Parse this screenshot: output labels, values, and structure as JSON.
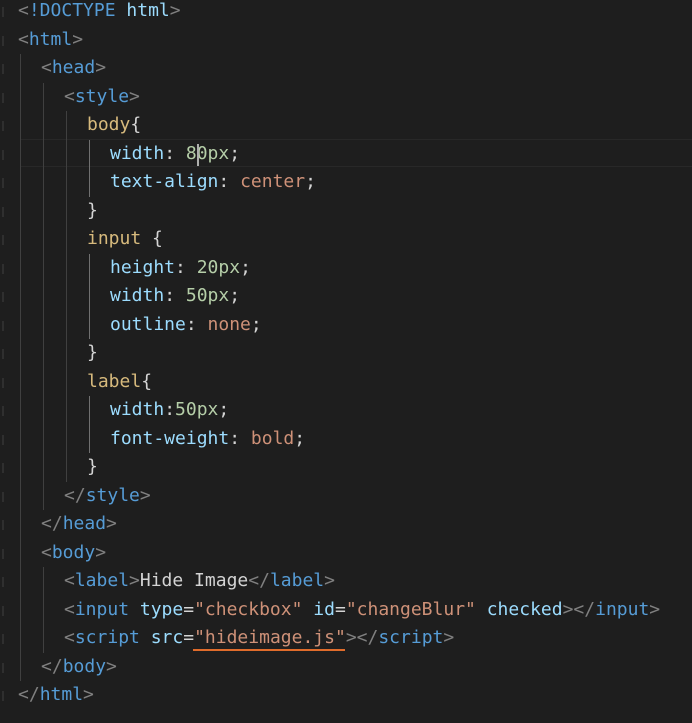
{
  "colors": {
    "background": "#1e1e1e",
    "punctuation": "#808080",
    "tag": "#569cd6",
    "attribute": "#9cdcfe",
    "string": "#ce9178",
    "selector": "#d7ba7d",
    "number": "#b5cea8",
    "text": "#d4d4d4"
  },
  "code": {
    "lines": [
      {
        "indent": 0,
        "tokens": [
          {
            "t": "<",
            "c": "punctuation"
          },
          {
            "t": "!DOCTYPE",
            "c": "tag"
          },
          {
            "t": " ",
            "c": "text"
          },
          {
            "t": "html",
            "c": "attribute"
          },
          {
            "t": ">",
            "c": "punctuation"
          }
        ]
      },
      {
        "indent": 0,
        "tokens": [
          {
            "t": "<",
            "c": "punctuation"
          },
          {
            "t": "html",
            "c": "tag"
          },
          {
            "t": ">",
            "c": "punctuation"
          }
        ]
      },
      {
        "indent": 1,
        "tokens": [
          {
            "t": "<",
            "c": "punctuation"
          },
          {
            "t": "head",
            "c": "tag"
          },
          {
            "t": ">",
            "c": "punctuation"
          }
        ]
      },
      {
        "indent": 2,
        "tokens": [
          {
            "t": "<",
            "c": "punctuation"
          },
          {
            "t": "style",
            "c": "tag"
          },
          {
            "t": ">",
            "c": "punctuation"
          }
        ]
      },
      {
        "indent": 3,
        "tokens": [
          {
            "t": "body",
            "c": "selector"
          },
          {
            "t": "{",
            "c": "text"
          }
        ]
      },
      {
        "indent": 4,
        "tokens": [
          {
            "t": "width",
            "c": "attribute"
          },
          {
            "t": ": ",
            "c": "text"
          },
          {
            "t": "80px",
            "c": "number"
          },
          {
            "t": ";",
            "c": "text"
          }
        ]
      },
      {
        "indent": 4,
        "tokens": [
          {
            "t": "text-align",
            "c": "attribute"
          },
          {
            "t": ": ",
            "c": "text"
          },
          {
            "t": "center",
            "c": "string"
          },
          {
            "t": ";",
            "c": "text"
          }
        ]
      },
      {
        "indent": 3,
        "tokens": [
          {
            "t": "}",
            "c": "text"
          }
        ]
      },
      {
        "indent": 3,
        "tokens": [
          {
            "t": "input",
            "c": "selector"
          },
          {
            "t": " {",
            "c": "text"
          }
        ]
      },
      {
        "indent": 4,
        "tokens": [
          {
            "t": "height",
            "c": "attribute"
          },
          {
            "t": ": ",
            "c": "text"
          },
          {
            "t": "20px",
            "c": "number"
          },
          {
            "t": ";",
            "c": "text"
          }
        ]
      },
      {
        "indent": 4,
        "tokens": [
          {
            "t": "width",
            "c": "attribute"
          },
          {
            "t": ": ",
            "c": "text"
          },
          {
            "t": "50px",
            "c": "number"
          },
          {
            "t": ";",
            "c": "text"
          }
        ]
      },
      {
        "indent": 4,
        "tokens": [
          {
            "t": "outline",
            "c": "attribute"
          },
          {
            "t": ": ",
            "c": "text"
          },
          {
            "t": "none",
            "c": "string"
          },
          {
            "t": ";",
            "c": "text"
          }
        ]
      },
      {
        "indent": 3,
        "tokens": [
          {
            "t": "}",
            "c": "text"
          }
        ]
      },
      {
        "indent": 3,
        "tokens": [
          {
            "t": "label",
            "c": "selector"
          },
          {
            "t": "{",
            "c": "text"
          }
        ]
      },
      {
        "indent": 4,
        "tokens": [
          {
            "t": "width",
            "c": "attribute"
          },
          {
            "t": ":",
            "c": "text"
          },
          {
            "t": "50px",
            "c": "number"
          },
          {
            "t": ";",
            "c": "text"
          }
        ]
      },
      {
        "indent": 4,
        "tokens": [
          {
            "t": "font-weight",
            "c": "attribute"
          },
          {
            "t": ": ",
            "c": "text"
          },
          {
            "t": "bold",
            "c": "string"
          },
          {
            "t": ";",
            "c": "text"
          }
        ]
      },
      {
        "indent": 3,
        "tokens": [
          {
            "t": "}",
            "c": "text"
          }
        ]
      },
      {
        "indent": 2,
        "tokens": [
          {
            "t": "</",
            "c": "punctuation"
          },
          {
            "t": "style",
            "c": "tag"
          },
          {
            "t": ">",
            "c": "punctuation"
          }
        ]
      },
      {
        "indent": 1,
        "tokens": [
          {
            "t": "</",
            "c": "punctuation"
          },
          {
            "t": "head",
            "c": "tag"
          },
          {
            "t": ">",
            "c": "punctuation"
          }
        ]
      },
      {
        "indent": 1,
        "tokens": [
          {
            "t": "<",
            "c": "punctuation"
          },
          {
            "t": "body",
            "c": "tag"
          },
          {
            "t": ">",
            "c": "punctuation"
          }
        ]
      },
      {
        "indent": 2,
        "tokens": [
          {
            "t": "<",
            "c": "punctuation"
          },
          {
            "t": "label",
            "c": "tag"
          },
          {
            "t": ">",
            "c": "punctuation"
          },
          {
            "t": "Hide Image",
            "c": "text"
          },
          {
            "t": "</",
            "c": "punctuation"
          },
          {
            "t": "label",
            "c": "tag"
          },
          {
            "t": ">",
            "c": "punctuation"
          }
        ]
      },
      {
        "indent": 2,
        "tokens": [
          {
            "t": "<",
            "c": "punctuation"
          },
          {
            "t": "input",
            "c": "tag"
          },
          {
            "t": " ",
            "c": "text"
          },
          {
            "t": "type",
            "c": "attribute"
          },
          {
            "t": "=",
            "c": "text"
          },
          {
            "t": "\"checkbox\"",
            "c": "string"
          },
          {
            "t": " ",
            "c": "text"
          },
          {
            "t": "id",
            "c": "attribute"
          },
          {
            "t": "=",
            "c": "text"
          },
          {
            "t": "\"changeBlur\"",
            "c": "string"
          },
          {
            "t": " ",
            "c": "text"
          },
          {
            "t": "checked",
            "c": "attribute"
          },
          {
            "t": ">",
            "c": "punctuation"
          },
          {
            "t": "</",
            "c": "punctuation"
          },
          {
            "t": "input",
            "c": "tag"
          },
          {
            "t": ">",
            "c": "punctuation"
          }
        ]
      },
      {
        "indent": 2,
        "tokens": [
          {
            "t": "<",
            "c": "punctuation"
          },
          {
            "t": "script",
            "c": "tag"
          },
          {
            "t": " ",
            "c": "text"
          },
          {
            "t": "src",
            "c": "attribute"
          },
          {
            "t": "=",
            "c": "text"
          },
          {
            "t": "\"",
            "c": "string"
          },
          {
            "t": "hideimage.js",
            "c": "string"
          },
          {
            "t": "\"",
            "c": "string"
          },
          {
            "t": ">",
            "c": "punctuation"
          },
          {
            "t": "</",
            "c": "punctuation"
          },
          {
            "t": "script",
            "c": "tag"
          },
          {
            "t": ">",
            "c": "punctuation"
          }
        ]
      },
      {
        "indent": 1,
        "tokens": [
          {
            "t": "</",
            "c": "punctuation"
          },
          {
            "t": "body",
            "c": "tag"
          },
          {
            "t": ">",
            "c": "punctuation"
          }
        ]
      },
      {
        "indent": 0,
        "tokens": [
          {
            "t": "</",
            "c": "punctuation"
          },
          {
            "t": "html",
            "c": "tag"
          },
          {
            "t": ">",
            "c": "punctuation"
          }
        ]
      }
    ]
  }
}
